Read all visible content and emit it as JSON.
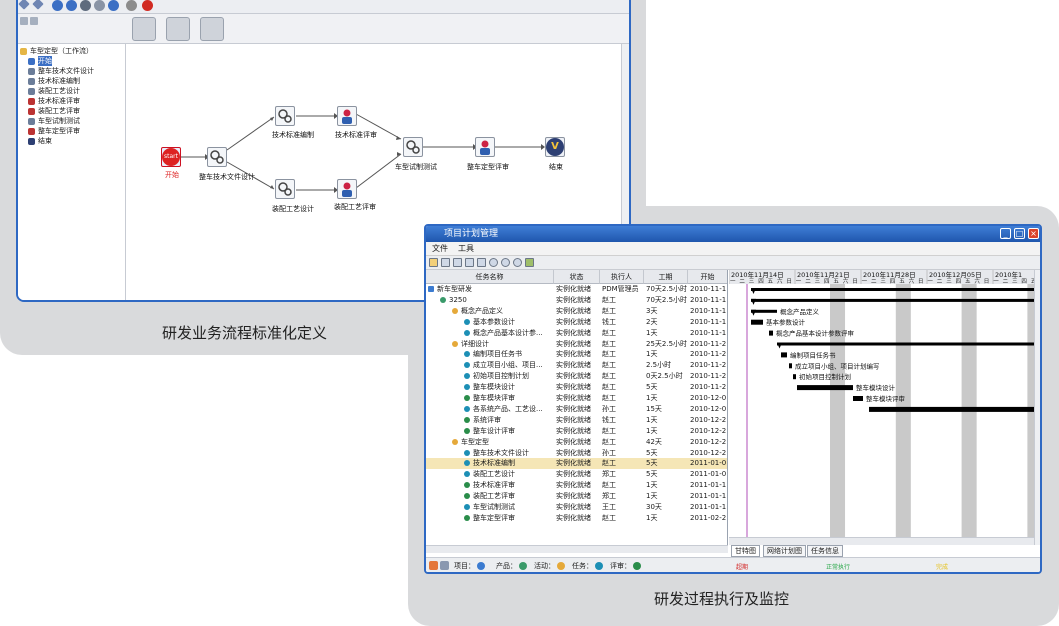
{
  "colors": {
    "window_border": "#2e68c3",
    "panel_bg": "#d9dadc",
    "gantt_bar": "#000000",
    "weekend_band": "#c9c9c9",
    "selected_row": "#f5e6b6",
    "start_red": "#d22222"
  },
  "captions": {
    "left": "研发业务流程标准化定义",
    "right": "研发过程执行及监控"
  },
  "workflow_window": {
    "tree_root": "车型定型（工作流）",
    "tree_items": [
      "开始",
      "整车技术文件设计",
      "技术标准编制",
      "装配工艺设计",
      "技术标准评审",
      "装配工艺评审",
      "车型试制测试",
      "整车定型评审",
      "结束"
    ],
    "nodes": {
      "start": "开始",
      "vehicle_doc_design": "整车技术文件设计",
      "tech_standard": "技术标准编制",
      "tech_review": "技术标准评审",
      "assembly_design": "装配工艺设计",
      "assembly_review": "装配工艺评审",
      "trial_test": "车型试制测试",
      "final_review": "整车定型评审",
      "end": "结束"
    },
    "start_icon_text": "start",
    "end_icon_text": "V"
  },
  "plan_window": {
    "title": "项目计划管理",
    "menu": [
      "文件",
      "工具"
    ],
    "columns": [
      "任务名称",
      "状态",
      "执行人",
      "工期",
      "开始"
    ],
    "rows": [
      {
        "level": 0,
        "name": "新车型研发",
        "status": "实例化就绪",
        "owner": "PDM管理员",
        "duration": "70天2.5小时",
        "start": "2010-11-1"
      },
      {
        "level": 1,
        "name": "3250",
        "status": "实例化就绪",
        "owner": "赵工",
        "duration": "70天2.5小时",
        "start": "2010-11-1"
      },
      {
        "level": 2,
        "name": "概念产品定义",
        "status": "实例化就绪",
        "owner": "赵工",
        "duration": "3天",
        "start": "2010-11-1"
      },
      {
        "level": 3,
        "name": "基本参数设计",
        "status": "实例化就绪",
        "owner": "钱工",
        "duration": "2天",
        "start": "2010-11-1"
      },
      {
        "level": 3,
        "name": "概念产品基本设计参...",
        "status": "实例化就绪",
        "owner": "赵工",
        "duration": "1天",
        "start": "2010-11-1"
      },
      {
        "level": 2,
        "name": "详细设计",
        "status": "实例化就绪",
        "owner": "赵工",
        "duration": "25天2.5小时",
        "start": "2010-11-2"
      },
      {
        "level": 3,
        "name": "编制项目任务书",
        "status": "实例化就绪",
        "owner": "赵工",
        "duration": "1天",
        "start": "2010-11-2"
      },
      {
        "level": 3,
        "name": "成立项目小组、项目...",
        "status": "实例化就绪",
        "owner": "赵工",
        "duration": "2.5小时",
        "start": "2010-11-2"
      },
      {
        "level": 3,
        "name": "初始项目控制计划",
        "status": "实例化就绪",
        "owner": "赵工",
        "duration": "0天2.5小时",
        "start": "2010-11-2"
      },
      {
        "level": 3,
        "name": "整车模块设计",
        "status": "实例化就绪",
        "owner": "赵工",
        "duration": "5天",
        "start": "2010-11-2"
      },
      {
        "level": 3,
        "name": "整车模块评审",
        "status": "实例化就绪",
        "owner": "赵工",
        "duration": "1天",
        "start": "2010-12-0"
      },
      {
        "level": 3,
        "name": "各系统产品、工艺设...",
        "status": "实例化就绪",
        "owner": "孙工",
        "duration": "15天",
        "start": "2010-12-0"
      },
      {
        "level": 3,
        "name": "系统评审",
        "status": "实例化就绪",
        "owner": "钱工",
        "duration": "1天",
        "start": "2010-12-2"
      },
      {
        "level": 3,
        "name": "整车设计评审",
        "status": "实例化就绪",
        "owner": "赵工",
        "duration": "1天",
        "start": "2010-12-2"
      },
      {
        "level": 2,
        "name": "车型定型",
        "status": "实例化就绪",
        "owner": "赵工",
        "duration": "42天",
        "start": "2010-12-2"
      },
      {
        "level": 3,
        "name": "整车技术文件设计",
        "status": "实例化就绪",
        "owner": "孙工",
        "duration": "5天",
        "start": "2010-12-2"
      },
      {
        "level": 3,
        "name": "技术标准编制",
        "status": "实例化就绪",
        "owner": "赵工",
        "duration": "5天",
        "start": "2011-01-0",
        "selected": true
      },
      {
        "level": 3,
        "name": "装配工艺设计",
        "status": "实例化就绪",
        "owner": "郑工",
        "duration": "5天",
        "start": "2011-01-0"
      },
      {
        "level": 3,
        "name": "技术标准评审",
        "status": "实例化就绪",
        "owner": "赵工",
        "duration": "1天",
        "start": "2011-01-1"
      },
      {
        "level": 3,
        "name": "装配工艺评审",
        "status": "实例化就绪",
        "owner": "郑工",
        "duration": "1天",
        "start": "2011-01-1"
      },
      {
        "level": 3,
        "name": "车型试制测试",
        "status": "实例化就绪",
        "owner": "王工",
        "duration": "30天",
        "start": "2011-01-1"
      },
      {
        "level": 3,
        "name": "整车定型评审",
        "status": "实例化就绪",
        "owner": "赵工",
        "duration": "1天",
        "start": "2011-02-2"
      }
    ],
    "gantt_weeks": [
      "2010年11月14日",
      "2010年11月21日",
      "2010年11月28日",
      "2010年12月05日",
      "2010年1"
    ],
    "gantt_days": [
      "一",
      "二",
      "三",
      "四",
      "五",
      "六",
      "日"
    ],
    "gantt_labels": [
      "概念产品定义",
      "基本参数设计",
      "概念产品基本设计参数评审",
      "编制项目任务书",
      "成立项目小组、项目计划编写",
      "初始项目控制计划",
      "整车模块设计",
      "整车模块评审"
    ],
    "bottom_tabs": [
      "甘特图",
      "网络计划图",
      "任务信息"
    ],
    "legend": [
      {
        "label": "项目：",
        "color": "#3b7bd0",
        "icon": "project-icon"
      },
      {
        "label": "产品：",
        "color": "#3a9a6a",
        "icon": "product-icon"
      },
      {
        "label": "活动：",
        "color": "#e5a93a",
        "icon": "activity-icon"
      },
      {
        "label": "任务：",
        "color": "#1c8fb5",
        "icon": "task-icon"
      },
      {
        "label": "评审：",
        "color": "#2a8d4a",
        "icon": "review-icon"
      }
    ],
    "status_labels": [
      {
        "text": "超期",
        "color": "#d22222"
      },
      {
        "text": "正常执行",
        "color": "#2aa84a"
      },
      {
        "text": "完成",
        "color": "#e6c21a"
      }
    ]
  }
}
